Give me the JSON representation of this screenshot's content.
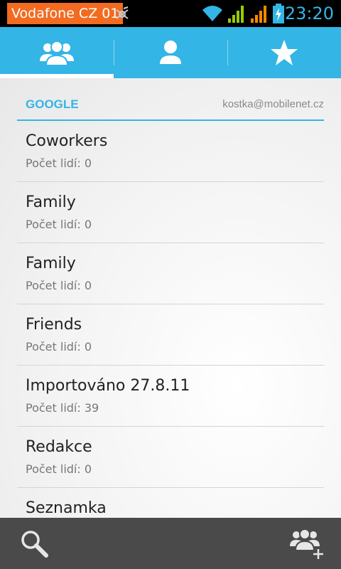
{
  "status_bar": {
    "carrier": "Vodafone CZ 01",
    "time": "23:20",
    "icons": [
      "usb-debug-icon",
      "wifi-icon",
      "signal-icon",
      "signal-roaming-icon",
      "battery-charging-icon"
    ]
  },
  "tabs": [
    {
      "icon": "groups-icon",
      "selected": true
    },
    {
      "icon": "person-icon",
      "selected": false
    },
    {
      "icon": "star-icon",
      "selected": false
    }
  ],
  "section": {
    "title": "GOOGLE",
    "account": "kostka@mobilenet.cz"
  },
  "groups": [
    {
      "name": "Coworkers",
      "count": "Počet lidí: 0"
    },
    {
      "name": "Family",
      "count": "Počet lidí: 0"
    },
    {
      "name": "Family",
      "count": "Počet lidí: 0"
    },
    {
      "name": "Friends",
      "count": "Počet lidí: 0"
    },
    {
      "name": "Importováno 27.8.11",
      "count": "Počet lidí: 39"
    },
    {
      "name": "Redakce",
      "count": "Počet lidí: 0"
    },
    {
      "name": "Seznamka",
      "count": ""
    }
  ],
  "bottom_bar": {
    "left_icon": "search-icon",
    "right_icon": "add-group-icon"
  },
  "colors": {
    "accent": "#33b5e5",
    "carrier_bg": "#f26b21",
    "signal_green": "#99cc00",
    "signal_orange": "#ff8800",
    "bottom_bar": "#4a4a4a"
  }
}
